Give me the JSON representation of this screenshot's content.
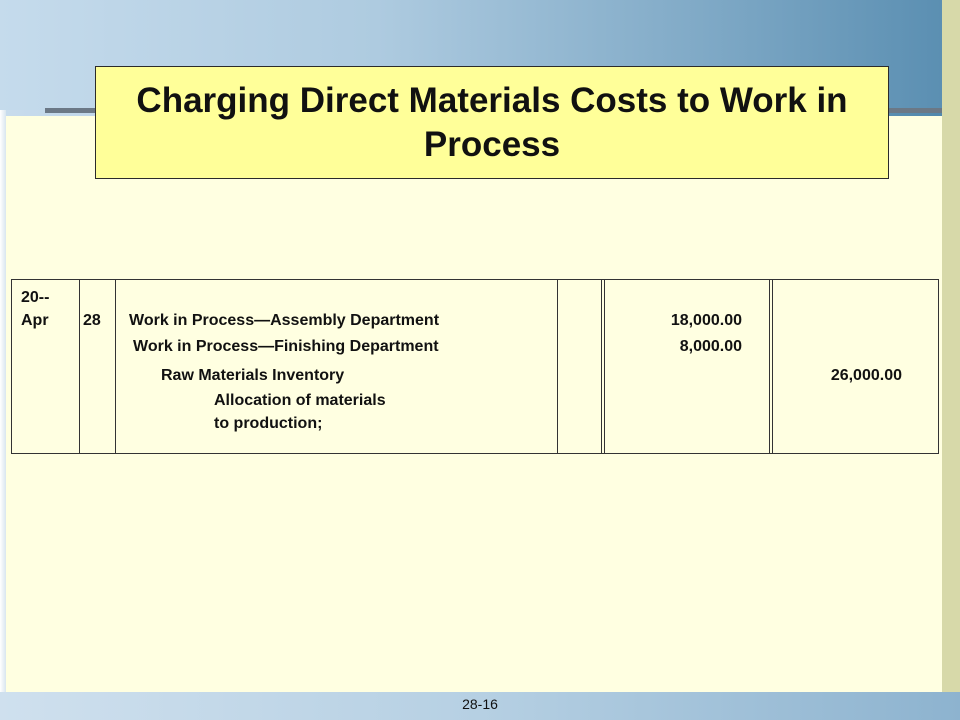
{
  "title": "Charging Direct Materials Costs to Work in Process",
  "journal": {
    "year": "20--",
    "month": "Apr",
    "day": "28",
    "entries": [
      {
        "account": "Work in Process—Assembly Department",
        "debit": "18,000.00",
        "credit": ""
      },
      {
        "account": "Work in Process—Finishing Department",
        "debit": "8,000.00",
        "credit": ""
      },
      {
        "account": "Raw Materials Inventory",
        "debit": "",
        "credit": "26,000.00"
      }
    ],
    "explanation_line1": "Allocation of materials",
    "explanation_line2": "to production;"
  },
  "footer": "28-16"
}
